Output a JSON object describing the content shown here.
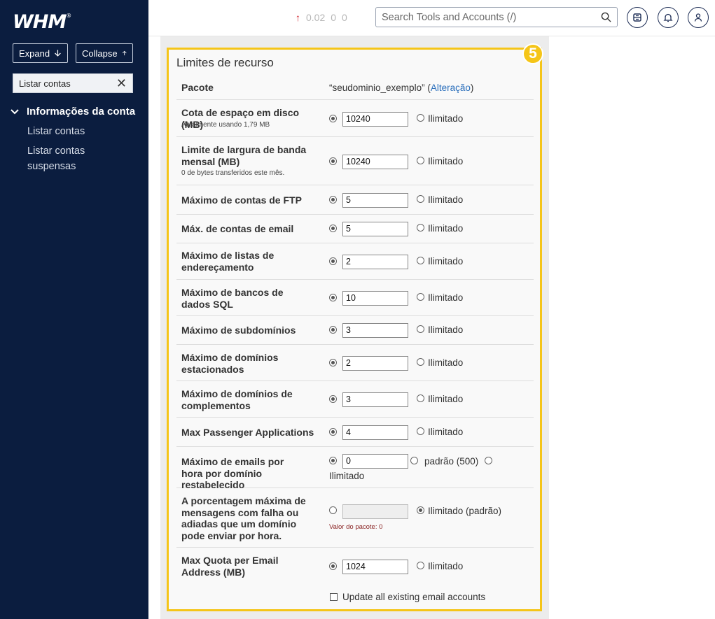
{
  "sidebar": {
    "logo": "WHM",
    "logo_mark": "®",
    "expand_label": "Expand",
    "collapse_label": "Collapse",
    "search_value": "Listar contas",
    "section_title": "Informações da conta",
    "links": [
      "Listar contas",
      "Listar contas suspensas"
    ]
  },
  "topbar": {
    "load": [
      "0.02",
      "0",
      "0"
    ],
    "search_placeholder": "Search Tools and Accounts (/)"
  },
  "panel": {
    "badge": "5",
    "title": "Limites de recurso",
    "package_label": "Pacote",
    "package_value": "“seudominio_exemplo”",
    "change_link": "Alteração",
    "unlimited": "Ilimitado",
    "rows": [
      {
        "label": "Cota de espaço em disco (MB)",
        "sub": "Atualmente usando 1,79 MB",
        "value": "10240"
      },
      {
        "label": "Limite de largura de banda mensal (MB)",
        "sub": "0 de bytes transferidos este mês.",
        "value": "10240"
      },
      {
        "label": "Máximo de contas de FTP",
        "value": "5"
      },
      {
        "label": "Máx. de contas de email",
        "value": "5"
      },
      {
        "label": "Máximo de listas de endereçamento",
        "value": "2"
      },
      {
        "label": "Máximo de bancos de dados SQL",
        "value": "10"
      },
      {
        "label": "Máximo de subdomínios",
        "value": "3"
      },
      {
        "label": "Máximo de domínios estacionados",
        "value": "2"
      },
      {
        "label": "Máximo de domínios de complementos",
        "value": "3"
      },
      {
        "label": "Max Passenger Applications",
        "value": "4"
      },
      {
        "label": "Máximo de emails por hora por domínio restabelecido",
        "value": "0",
        "default_label": "padrão (500)"
      },
      {
        "label": "A porcentagem máxima de mensagens com falha ou adiadas que um domínio pode enviar por hora.",
        "value": "",
        "unlimited_default": "Ilimitado (padrão)",
        "package_value": "Valor do pacote: 0"
      },
      {
        "label": "Max Quota per Email Address (MB)",
        "value": "1024"
      }
    ],
    "update_all_label": "Update all existing email accounts"
  }
}
